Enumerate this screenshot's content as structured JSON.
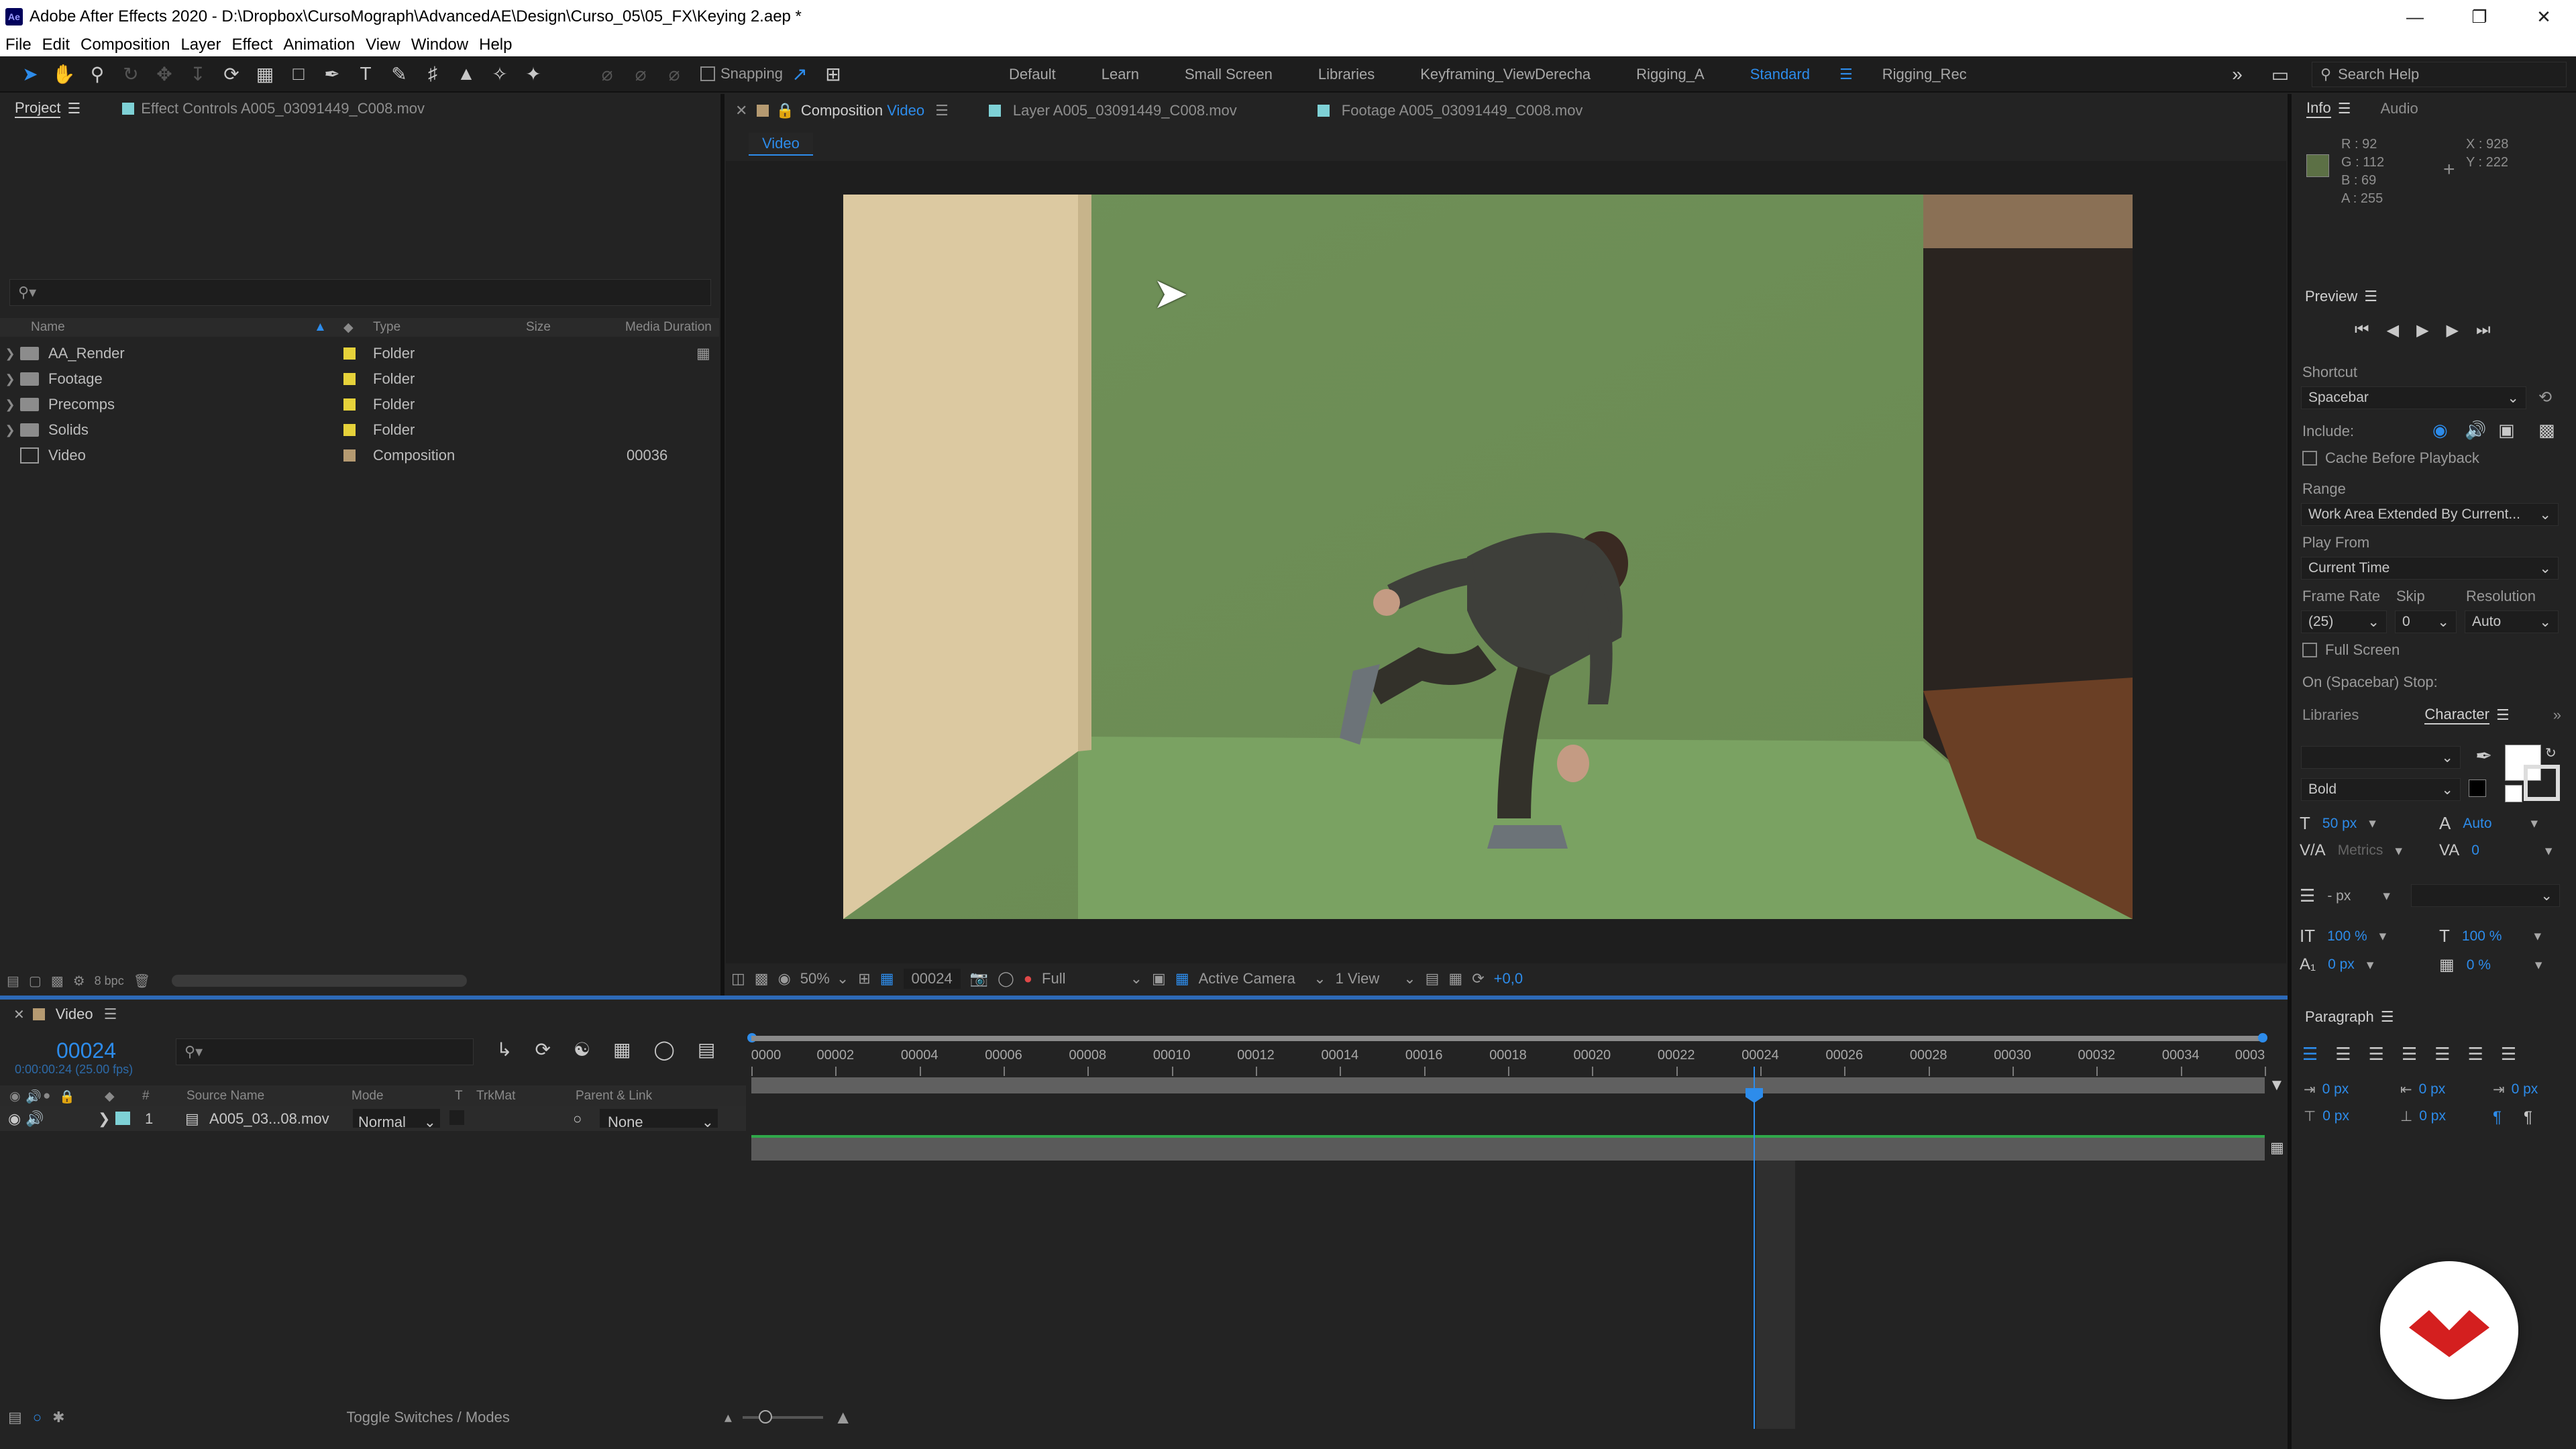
{
  "app": {
    "title": "Adobe After Effects 2020 - D:\\Dropbox\\CursoMograph\\AdvancedAE\\Design\\Curso_05\\05_FX\\Keying 2.aep *",
    "icon_label": "Ae"
  },
  "menu": [
    "File",
    "Edit",
    "Composition",
    "Layer",
    "Effect",
    "Animation",
    "View",
    "Window",
    "Help"
  ],
  "toolbar": {
    "snapping_label": "Snapping",
    "workspaces": [
      "Default",
      "Learn",
      "Small Screen",
      "Libraries",
      "Keyframing_ViewDerecha",
      "Rigging_A",
      "Standard",
      "Rigging_Rec"
    ],
    "active_workspace": "Standard",
    "search_help_placeholder": "Search Help"
  },
  "project_panel": {
    "tab_project": "Project",
    "tab_effect_controls": "Effect Controls A005_03091449_C008.mov",
    "columns": {
      "name": "Name",
      "type": "Type",
      "size": "Size",
      "media_duration": "Media Duration"
    },
    "items": [
      {
        "name": "AA_Render",
        "type": "Folder",
        "duration": "",
        "label_color": "#e6d23a"
      },
      {
        "name": "Footage",
        "type": "Folder",
        "duration": "",
        "label_color": "#e6d23a"
      },
      {
        "name": "Precomps",
        "type": "Folder",
        "duration": "",
        "label_color": "#e6d23a"
      },
      {
        "name": "Solids",
        "type": "Folder",
        "duration": "",
        "label_color": "#e6d23a"
      },
      {
        "name": "Video",
        "type": "Composition",
        "duration": "00036",
        "label_color": "#b59a71"
      }
    ],
    "bit_depth": "8 bpc"
  },
  "viewer": {
    "tab_composition": "Composition",
    "tab_composition_name": "Video",
    "tab_layer": "Layer  A005_03091449_C008.mov",
    "tab_footage": "Footage  A005_03091449_C008.mov",
    "sub_tab": "Video",
    "zoom": "50%",
    "timecode": "00024",
    "resolution": "Full",
    "camera": "Active Camera",
    "views": "1 View",
    "exposure": "+0,0"
  },
  "info": {
    "tab_info": "Info",
    "tab_audio": "Audio",
    "r": "R : 92",
    "g": "G : 112",
    "b": "B : 69",
    "a": "A : 255",
    "x": "X : 928",
    "y": "Y : 222",
    "sample_color": "#5c7045"
  },
  "preview": {
    "title": "Preview",
    "shortcut_label": "Shortcut",
    "shortcut_value": "Spacebar",
    "include_label": "Include:",
    "cache_label": "Cache Before Playback",
    "range_label": "Range",
    "range_value": "Work Area Extended By Current...",
    "play_from_label": "Play From",
    "play_from_value": "Current Time",
    "frame_rate_label": "Frame Rate",
    "skip_label": "Skip",
    "resolution_label": "Resolution",
    "frame_rate_value": "(25)",
    "skip_value": "0",
    "resolution_value": "Auto",
    "full_screen_label": "Full Screen",
    "stop_label": "On (Spacebar) Stop:"
  },
  "character": {
    "tab_libraries": "Libraries",
    "tab_character": "Character",
    "font_style": "Bold",
    "font_size": "50 px",
    "leading": "Auto",
    "kerning": "Metrics",
    "tracking": "0",
    "stroke_width": "- px",
    "vert_scale": "100 %",
    "horiz_scale": "100 %",
    "baseline": "0 px",
    "tsume": "0 %"
  },
  "paragraph": {
    "title": "Paragraph",
    "indent_left": "0 px",
    "indent_right": "0 px",
    "indent_first": "0 px",
    "space_before": "0 px",
    "space_after": "0 px"
  },
  "timeline": {
    "tab": "Video",
    "timecode": "00024",
    "fps_readout": "0:00:00:24 (25.00 fps)",
    "columns": {
      "source_name": "Source Name",
      "mode": "Mode",
      "t": "T",
      "trkmat": "TrkMat",
      "parent": "Parent & Link"
    },
    "layer": {
      "index": "1",
      "name": "A005_03...08.mov",
      "mode": "Normal",
      "parent": "None",
      "label_color": "#7ed1d6"
    },
    "ruler": [
      "0000",
      "00002",
      "00004",
      "00006",
      "00008",
      "00010",
      "00012",
      "00014",
      "00016",
      "00018",
      "00020",
      "00022",
      "00024",
      "00026",
      "00028",
      "00030",
      "00032",
      "00034",
      "0003"
    ],
    "toggle_label": "Toggle Switches / Modes"
  },
  "colors": {
    "accent": "#2d8ceb",
    "panel_bg": "#232323",
    "dark_bg": "#1d1d1d",
    "layer_bar_green": "#2fa84a"
  }
}
